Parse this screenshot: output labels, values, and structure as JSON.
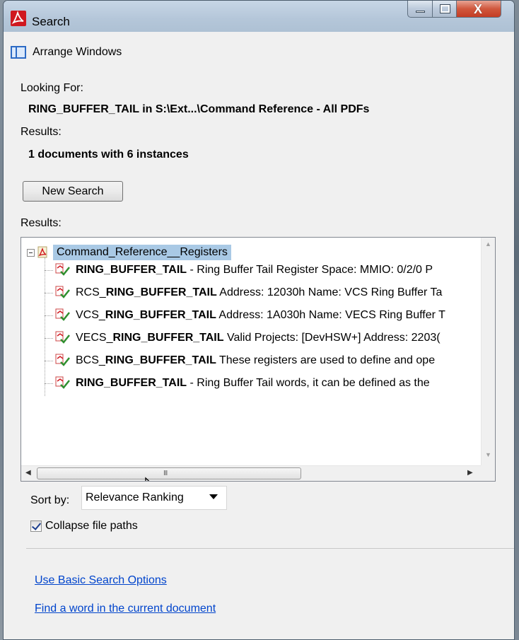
{
  "window": {
    "title": "Search",
    "controls": [
      "minimize",
      "maximize",
      "close"
    ]
  },
  "arrange_windows": {
    "label": "Arrange Windows",
    "icon": "arrange-windows-icon"
  },
  "looking_for": {
    "label": "Looking For:",
    "value": "RING_BUFFER_TAIL in S:\\Ext...\\Command Reference - All PDFs"
  },
  "results_summary": {
    "label": "Results:",
    "value": "1 documents with 6 instances"
  },
  "new_search": {
    "label": "New Search"
  },
  "results_list": {
    "label": "Results:",
    "root": {
      "label": "Command_Reference__Registers",
      "expanded": true,
      "selected": true
    },
    "items": [
      {
        "prefix": "",
        "match": "RING_BUFFER_TAIL",
        "suffix": " - Ring Buffer Tail Register Space: MMIO: 0/2/0 P"
      },
      {
        "prefix": "RCS_",
        "match": "RING_BUFFER_TAIL",
        "suffix": " Address: 12030h Name: VCS Ring Buffer Ta"
      },
      {
        "prefix": "VCS_",
        "match": "RING_BUFFER_TAIL",
        "suffix": " Address: 1A030h Name: VECS Ring Buffer T"
      },
      {
        "prefix": "VECS_",
        "match": "RING_BUFFER_TAIL",
        "suffix": " Valid Projects: [DevHSW+] Address: 2203("
      },
      {
        "prefix": "BCS_",
        "match": "RING_BUFFER_TAIL",
        "suffix": " These registers are used to define and ope"
      },
      {
        "prefix": "",
        "match": "RING_BUFFER_TAIL",
        "suffix": " - Ring Buffer Tail words, it can be defined as the"
      }
    ],
    "hscroll_grip": "III"
  },
  "sort": {
    "label": "Sort by:",
    "selected": "Relevance Ranking"
  },
  "collapse_paths": {
    "label": "Collapse file paths",
    "checked": true
  },
  "links": {
    "basic_search": "Use Basic Search Options",
    "find_word": "Find a word in the current document"
  },
  "colors": {
    "selection": "#a9c9e5",
    "link": "#0044cc",
    "titlebar": "#b4c6d9",
    "close_button": "#d0573d"
  }
}
